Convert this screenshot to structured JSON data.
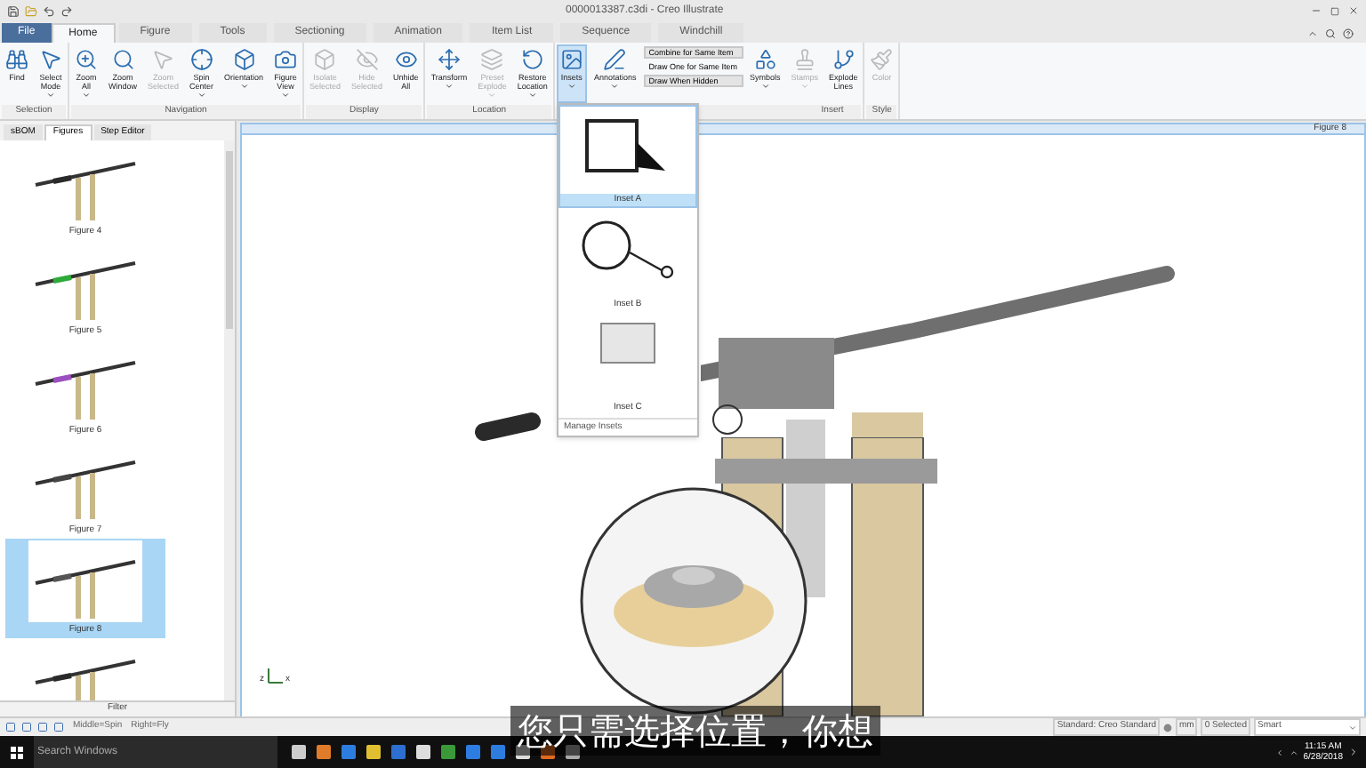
{
  "window": {
    "title": "0000013387.c3di - Creo Illustrate"
  },
  "ribbon_tabs": [
    {
      "label": "File",
      "kind": "file",
      "selected": false
    },
    {
      "label": "Home",
      "kind": "tab",
      "selected": true
    },
    {
      "label": "Figure",
      "kind": "tab",
      "selected": false
    },
    {
      "label": "Tools",
      "kind": "tab",
      "selected": false
    },
    {
      "label": "Sectioning",
      "kind": "tab",
      "selected": false
    },
    {
      "label": "Animation",
      "kind": "tab",
      "selected": false
    },
    {
      "label": "Item List",
      "kind": "tab",
      "selected": false
    },
    {
      "label": "Sequence",
      "kind": "tab",
      "selected": false
    },
    {
      "label": "Windchill",
      "kind": "tab",
      "selected": false
    }
  ],
  "ribbon_groups": [
    {
      "label": "Selection",
      "buttons": [
        {
          "label": "Find",
          "disabled": false,
          "menu": false,
          "selected": false
        },
        {
          "label": "Select Mode",
          "disabled": false,
          "menu": true,
          "selected": false
        }
      ]
    },
    {
      "label": "Navigation",
      "buttons": [
        {
          "label": "Zoom All",
          "disabled": false,
          "menu": true,
          "selected": false
        },
        {
          "label": "Zoom Window",
          "disabled": false,
          "menu": false,
          "selected": false
        },
        {
          "label": "Zoom Selected",
          "disabled": true,
          "menu": false,
          "selected": false
        },
        {
          "label": "Spin Center",
          "disabled": false,
          "menu": true,
          "selected": false
        },
        {
          "label": "Orientation",
          "disabled": false,
          "menu": true,
          "selected": false
        },
        {
          "label": "Figure View",
          "disabled": false,
          "menu": true,
          "selected": false
        }
      ]
    },
    {
      "label": "Display",
      "buttons": [
        {
          "label": "Isolate Selected",
          "disabled": true,
          "menu": false,
          "selected": false
        },
        {
          "label": "Hide Selected",
          "disabled": true,
          "menu": false,
          "selected": false
        },
        {
          "label": "Unhide All",
          "disabled": false,
          "menu": false,
          "selected": false
        }
      ]
    },
    {
      "label": "Location",
      "buttons": [
        {
          "label": "Transform",
          "disabled": false,
          "menu": true,
          "selected": false
        },
        {
          "label": "Preset Explode",
          "disabled": true,
          "menu": true,
          "selected": false
        },
        {
          "label": "Restore Location",
          "disabled": false,
          "menu": true,
          "selected": false
        }
      ]
    },
    {
      "label": "Insert",
      "buttons": [
        {
          "label": "Insets",
          "disabled": false,
          "menu": true,
          "selected": true
        },
        {
          "label": "Annotations",
          "disabled": false,
          "menu": true,
          "selected": false
        }
      ],
      "small_buttons": [
        {
          "label": "Combine for Same Item",
          "selected": true
        },
        {
          "label": "Draw One for Same Item",
          "selected": false
        },
        {
          "label": "Draw When Hidden",
          "selected": true
        }
      ],
      "more_buttons": [
        {
          "label": "Symbols",
          "disabled": false,
          "menu": true,
          "selected": false
        },
        {
          "label": "Stamps",
          "disabled": true,
          "menu": true,
          "selected": false
        },
        {
          "label": "Explode Lines",
          "disabled": false,
          "menu": false,
          "selected": false
        }
      ]
    },
    {
      "label": "Style",
      "buttons": [
        {
          "label": "Color",
          "disabled": true,
          "menu": false,
          "selected": false
        }
      ]
    }
  ],
  "panel_tabs": [
    {
      "label": "sBOM",
      "selected": false
    },
    {
      "label": "Figures",
      "selected": true
    },
    {
      "label": "Step Editor",
      "selected": false
    }
  ],
  "figures": [
    {
      "label": "Figure 4",
      "selected": false
    },
    {
      "label": "Figure 5",
      "selected": false
    },
    {
      "label": "Figure 6",
      "selected": false
    },
    {
      "label": "Figure 7",
      "selected": false
    },
    {
      "label": "Figure 8",
      "selected": true
    },
    {
      "selected": false
    }
  ],
  "filter": "Filter",
  "canvas": {
    "title": "Figure 8",
    "triad": [
      "z",
      "x"
    ]
  },
  "insets_menu": {
    "items": [
      {
        "label": "Inset A",
        "kind": "callout",
        "selected": true
      },
      {
        "label": "Inset B",
        "kind": "circle",
        "selected": false
      },
      {
        "label": "Inset C",
        "kind": "box",
        "selected": false
      }
    ],
    "footer": "Manage Insets"
  },
  "status_bar": {
    "hints": [
      "Middle=Spin",
      "Right=Fly"
    ],
    "standard": "Standard: Creo Standard",
    "units": "mm",
    "selection": "0 Selected",
    "filter": "Smart"
  },
  "taskbar": {
    "search": "Search Windows",
    "time": "11:15 AM",
    "date": "6/28/2018"
  },
  "subtitle": "您只需选择位置，你想"
}
